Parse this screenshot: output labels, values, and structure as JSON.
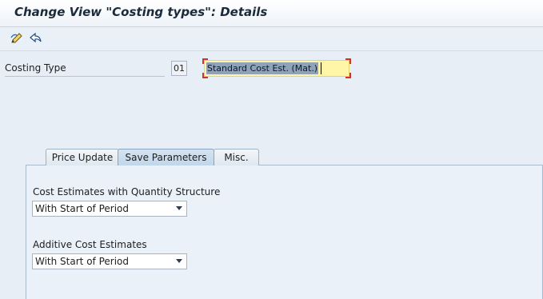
{
  "window": {
    "title": "Change View \"Costing types\": Details"
  },
  "toolbar": {
    "buttons": [
      {
        "icon": "display-change-icon"
      },
      {
        "icon": "other-view-icon"
      }
    ]
  },
  "costing_type": {
    "label": "Costing Type",
    "code": "01",
    "description": "Standard Cost Est. (Mat.)"
  },
  "tabs": [
    {
      "label": "Price Update",
      "active": false
    },
    {
      "label": "Save Parameters",
      "active": true
    },
    {
      "label": "Misc.",
      "active": false
    }
  ],
  "save_parameters": {
    "qty_structure": {
      "label": "Cost Estimates with Quantity Structure",
      "value": "With Start of Period"
    },
    "additive": {
      "label": "Additive Cost Estimates",
      "value": "With Start of Period"
    }
  }
}
